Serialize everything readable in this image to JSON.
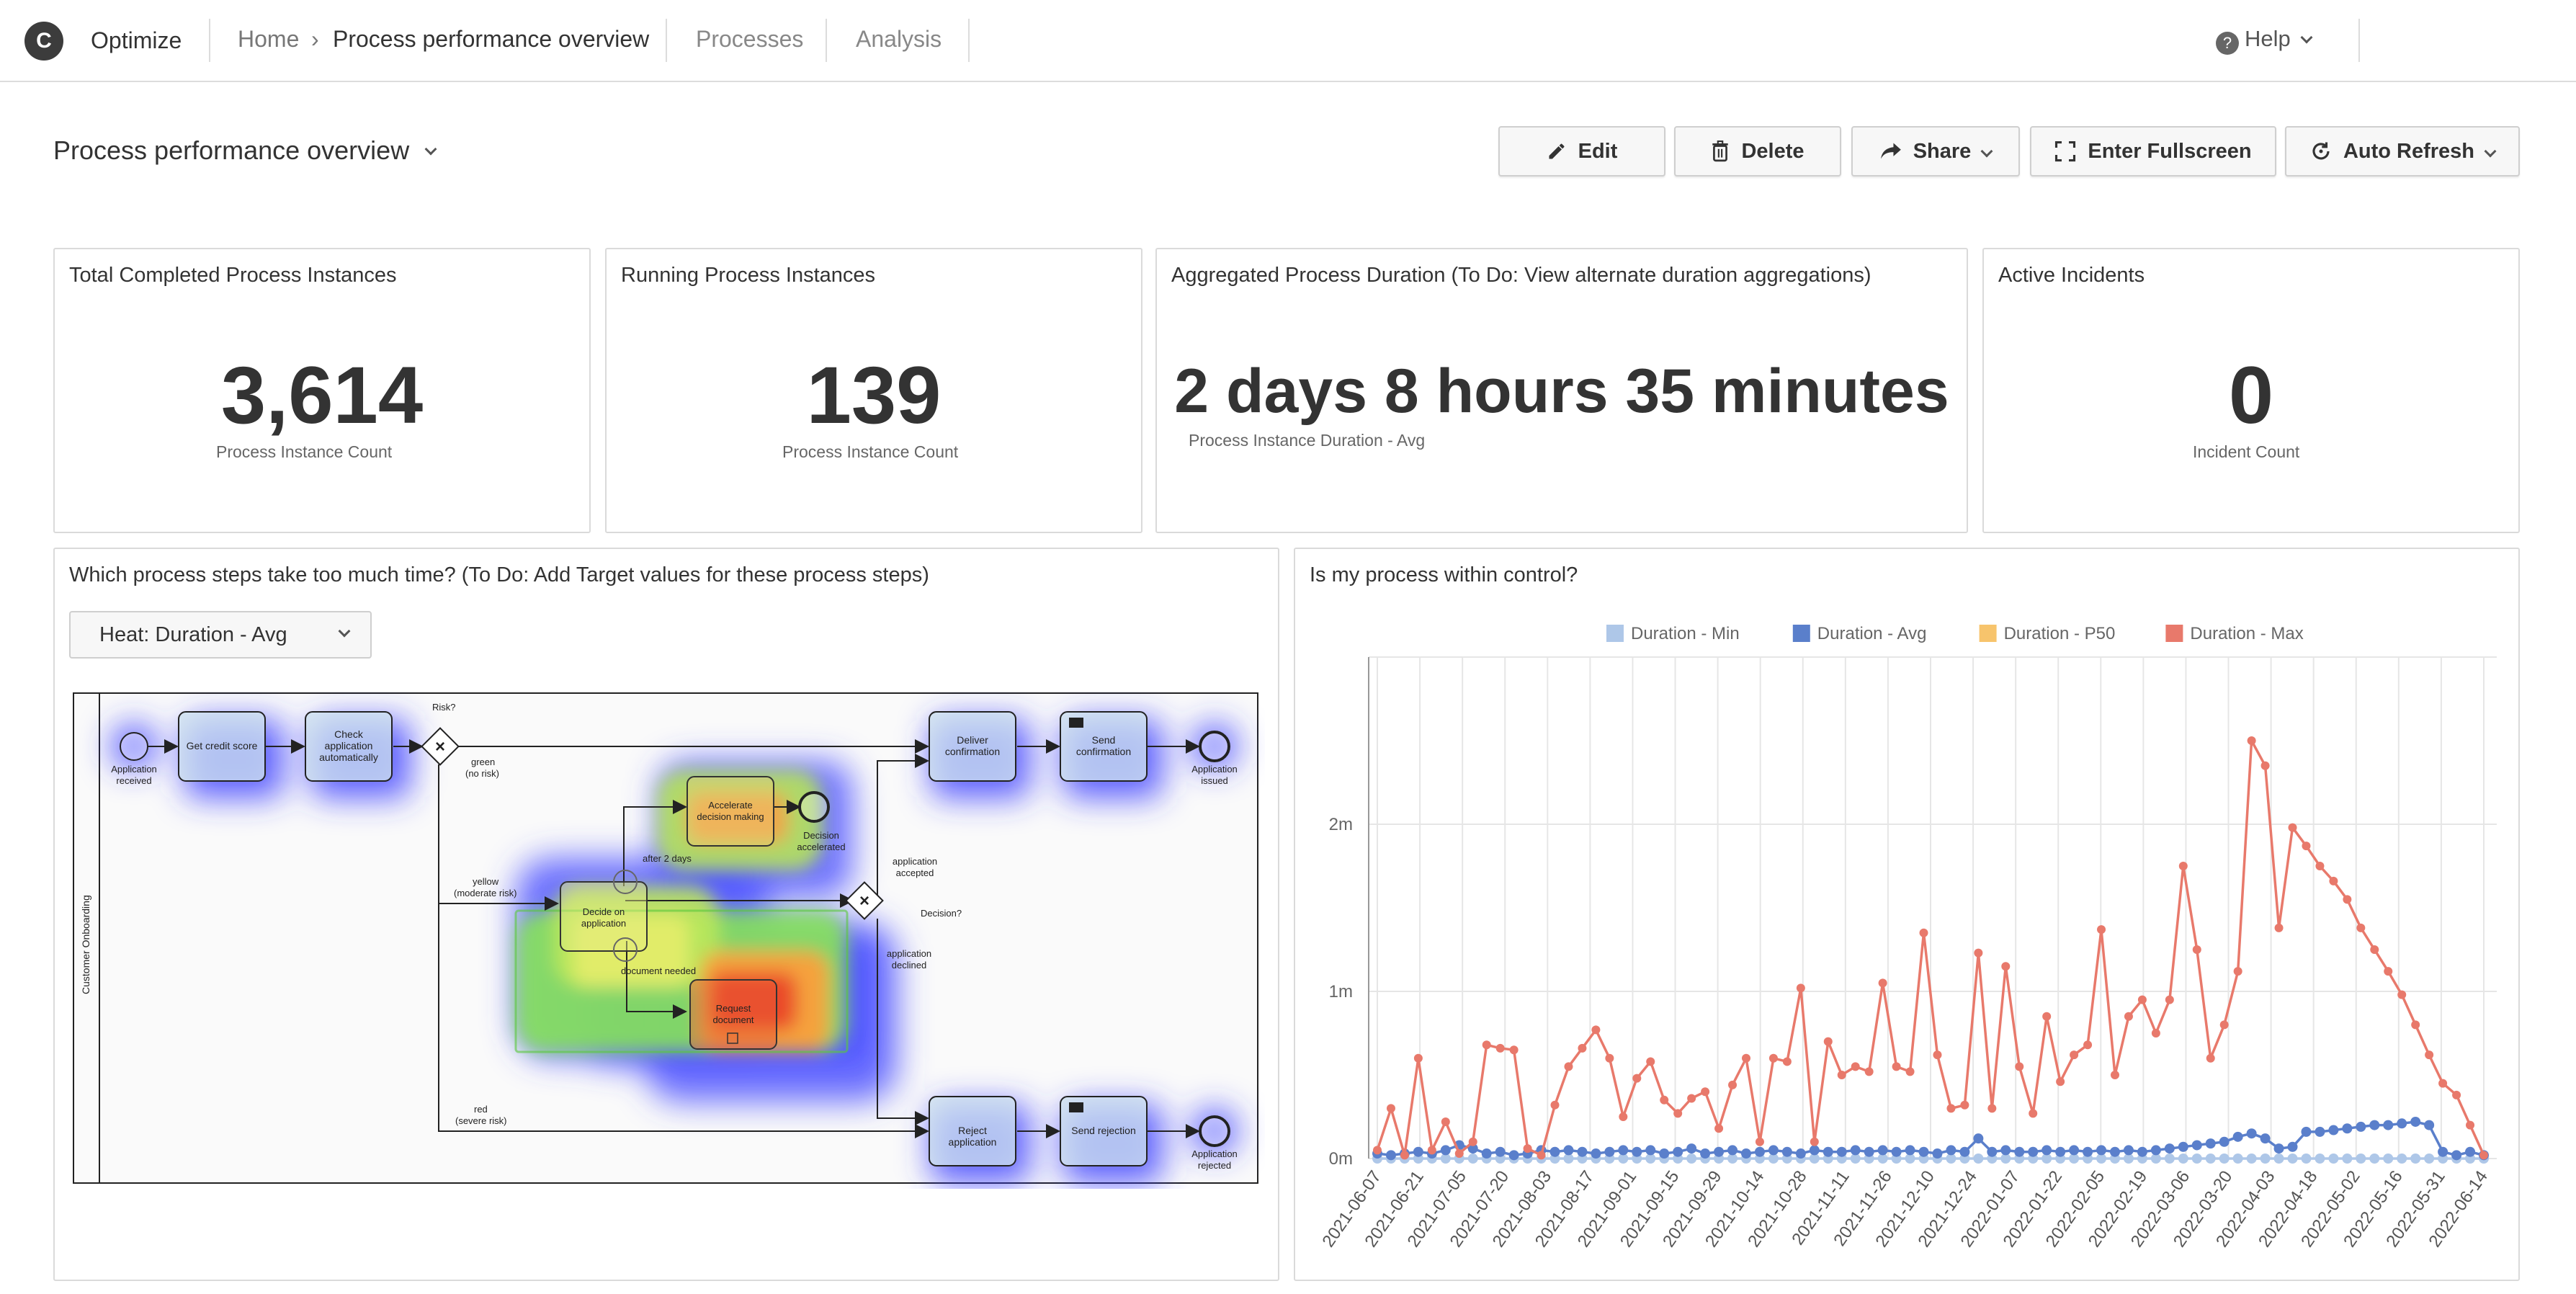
{
  "app": {
    "name": "Optimize"
  },
  "breadcrumb": {
    "home": "Home",
    "separator": "›",
    "current": "Process performance overview"
  },
  "nav": {
    "processes": "Processes",
    "analysis": "Analysis"
  },
  "help": {
    "label": "Help",
    "icon": "?"
  },
  "dashboard": {
    "title": "Process performance overview"
  },
  "toolbar": {
    "edit": "Edit",
    "delete": "Delete",
    "share": "Share",
    "fullscreen": "Enter Fullscreen",
    "auto_refresh": "Auto Refresh"
  },
  "kpis": [
    {
      "title": "Total Completed Process Instances",
      "value": "3,614",
      "label": "Process Instance Count"
    },
    {
      "title": "Running Process Instances",
      "value": "139",
      "label": "Process Instance Count"
    },
    {
      "title": "Aggregated Process Duration (To Do: View alternate duration aggregations)",
      "value": "2 days 8 hours 35 minutes",
      "label": "Process Instance Duration - Avg"
    },
    {
      "title": "Active Incidents",
      "value": "0",
      "label": "Incident Count"
    }
  ],
  "heatmap_report": {
    "title": "Which process steps take too much time? (To Do: Add Target values for these process steps)",
    "select": "Heat: Duration - Avg",
    "pool": "Customer Onboarding",
    "labels": {
      "start": "Application\nreceived",
      "get_score": "Get credit score",
      "check": "Check\napplication\nautomatically",
      "risk": "Risk?",
      "green": "green\n(no risk)",
      "yellow": "yellow\n(moderate risk)",
      "red": "red\n(severe risk)",
      "accelerate": "Accelerate\ndecision making",
      "decision_accel": "Decision\naccelerated",
      "after2": "after 2 days",
      "decide": "Decide on\napplication",
      "doc_needed": "document needed",
      "request": "Request\ndocument",
      "decision": "Decision?",
      "accepted": "application\naccepted",
      "declined": "application\ndeclined",
      "deliver": "Deliver\nconfirmation",
      "send_conf": "Send\nconfirmation",
      "issued": "Application\nissued",
      "reject": "Reject\napplication",
      "send_rej": "Send rejection",
      "rejected": "Application\nrejected"
    }
  },
  "control_report": {
    "title": "Is my process within control?"
  },
  "chart_data": {
    "type": "line",
    "legend_position": "top",
    "series": [
      {
        "name": "Duration - Min",
        "color": "#aec7e8"
      },
      {
        "name": "Duration - Avg",
        "color": "#5a7fcb"
      },
      {
        "name": "Duration - P50",
        "color": "#f7c46c"
      },
      {
        "name": "Duration - Max",
        "color": "#e8796b"
      }
    ],
    "y_ticks": [
      "0m",
      "1m",
      "2m"
    ],
    "ylim": [
      0,
      3
    ],
    "x_ticks": [
      "2021-06-07",
      "2021-06-21",
      "2021-07-05",
      "2021-07-20",
      "2021-08-03",
      "2021-08-17",
      "2021-09-01",
      "2021-09-15",
      "2021-09-29",
      "2021-10-14",
      "2021-10-28",
      "2021-11-11",
      "2021-11-26",
      "2021-12-10",
      "2021-12-24",
      "2022-01-07",
      "2022-01-22",
      "2022-02-05",
      "2022-02-19",
      "2022-03-06",
      "2022-03-20",
      "2022-04-03",
      "2022-04-18",
      "2022-05-02",
      "2022-05-16",
      "2022-05-31",
      "2022-06-14"
    ],
    "max_values": [
      0.05,
      0.3,
      0.02,
      0.6,
      0.05,
      0.22,
      0.03,
      0.1,
      0.68,
      0.66,
      0.65,
      0.06,
      0.02,
      0.32,
      0.55,
      0.66,
      0.77,
      0.6,
      0.25,
      0.48,
      0.58,
      0.35,
      0.27,
      0.36,
      0.4,
      0.18,
      0.44,
      0.6,
      0.1,
      0.6,
      0.58,
      1.02,
      0.1,
      0.7,
      0.5,
      0.55,
      0.52,
      1.05,
      0.55,
      0.52,
      1.35,
      0.62,
      0.3,
      0.32,
      1.23,
      0.3,
      1.15,
      0.55,
      0.27,
      0.85,
      0.46,
      0.62,
      0.68,
      1.37,
      0.5,
      0.85,
      0.95,
      0.75,
      0.95,
      1.75,
      1.25,
      0.6,
      0.8,
      1.12,
      2.5,
      2.35,
      1.38,
      1.98,
      1.87,
      1.75,
      1.66,
      1.55,
      1.38,
      1.25,
      1.12,
      0.98,
      0.8,
      0.62,
      0.45,
      0.38,
      0.2,
      0.02
    ],
    "avg_values": [
      0.03,
      0.02,
      0.03,
      0.04,
      0.03,
      0.05,
      0.08,
      0.06,
      0.03,
      0.04,
      0.02,
      0.03,
      0.05,
      0.04,
      0.05,
      0.04,
      0.03,
      0.04,
      0.05,
      0.04,
      0.05,
      0.03,
      0.04,
      0.06,
      0.03,
      0.04,
      0.05,
      0.03,
      0.04,
      0.05,
      0.04,
      0.03,
      0.05,
      0.04,
      0.04,
      0.05,
      0.04,
      0.05,
      0.04,
      0.05,
      0.04,
      0.03,
      0.05,
      0.04,
      0.12,
      0.04,
      0.05,
      0.04,
      0.04,
      0.05,
      0.04,
      0.05,
      0.04,
      0.05,
      0.04,
      0.05,
      0.04,
      0.05,
      0.06,
      0.07,
      0.08,
      0.09,
      0.1,
      0.13,
      0.15,
      0.12,
      0.06,
      0.07,
      0.16,
      0.16,
      0.17,
      0.18,
      0.19,
      0.2,
      0.2,
      0.21,
      0.22,
      0.2,
      0.04,
      0.02,
      0.04,
      0.02
    ],
    "min_values": "≈0"
  }
}
